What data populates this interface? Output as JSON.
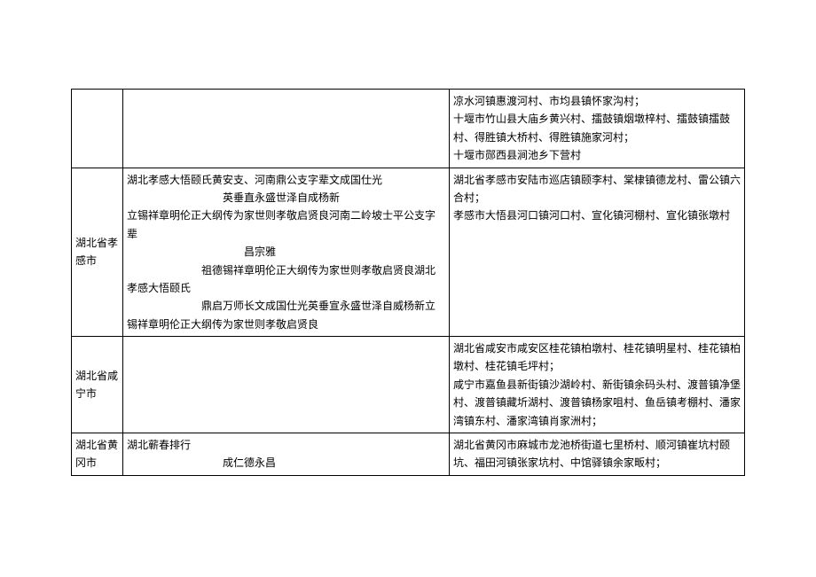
{
  "rows": [
    {
      "region": "",
      "mid": "",
      "right_lines": [
        "凉水河镇惠渡河村、市均县镇怀家沟村；",
        "十堰市竹山县大庙乡黄兴村、擂鼓镇烟墩梓村、擂鼓镇擂鼓村、得胜镇大桥村、得胜镇施家河村；",
        "十堰市郧西县涧池乡下营村"
      ]
    },
    {
      "region": "湖北省孝感市",
      "mid_lines": [
        "湖北孝感大悟颐氏黄安支、河南鼎公支字辈文成国仕光",
        "　　　　　　　　　英垂直永盛世泽自成杨新",
        "立锡祥章明伦正大纲传为家世则孝敬启贤良河南二岭坡士平公支字辈",
        "　　　　　　　　　　　昌宗雅",
        "　　　　　　　祖德锡祥章明伦正大纲传为家世则孝敬启贤良湖北",
        "孝感大悟颐氏",
        "　　　　　　　鼎启万师长文成国仕光英垂宣永盛世泽自威杨新立锡祥章明伦正大纲传为家世则孝敬启贤良"
      ],
      "right_lines": [
        "湖北省孝感市安陆市巡店镇颐李村、棠棣镇德龙村、雷公镇六合村；",
        "孝感市大悟县河口镇河口村、宣化镇河棚村、宣化镇张墩村"
      ]
    },
    {
      "region": "湖北省咸宁市",
      "mid": "",
      "right_lines": [
        "湖北省咸安市咸安区桂花镇柏墩村、桂花镇明星村、桂花镇柏墩村、桂花镇毛坪村；",
        "咸宁市嘉鱼县新街镇沙湖岭村、新街镇余码头村、渡普镇净堡村、渡普镇藏圻湖村、渡普镇杨家咀村、鱼岳镇考棚村、潘家湾镇东村、潘家湾镇肖家洲村；"
      ]
    },
    {
      "region": "湖北省黄冈市",
      "mid_lines": [
        "湖北蕲春排行",
        "　　　　　　　　　成仁德永昌"
      ],
      "right_lines": [
        "湖北省黄冈市麻城市龙池桥街道七里桥村、顺河镇崔坑村颐坑、福田河镇张家坑村、中馆驿镇余家畈村；"
      ]
    }
  ]
}
